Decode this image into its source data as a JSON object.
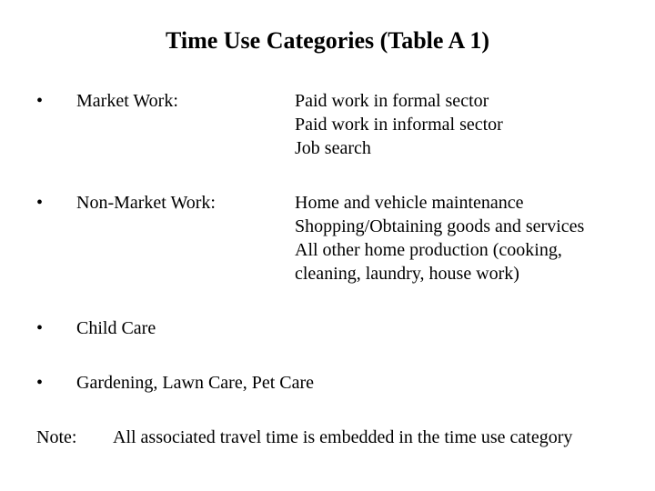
{
  "title": "Time Use Categories (Table A 1)",
  "bullet": "•",
  "items": [
    {
      "label": "Market Work:",
      "desc": "Paid work in formal sector\nPaid work in informal sector\nJob search"
    },
    {
      "label": "Non-Market Work:",
      "desc": "Home and vehicle maintenance\nShopping/Obtaining goods and services\nAll other home production (cooking, cleaning, laundry, house work)"
    },
    {
      "label": "Child Care",
      "desc": ""
    },
    {
      "label": "Gardening, Lawn Care, Pet Care",
      "desc": ""
    }
  ],
  "note": {
    "label": "Note:",
    "text": "All associated travel time is embedded in the time use category"
  }
}
